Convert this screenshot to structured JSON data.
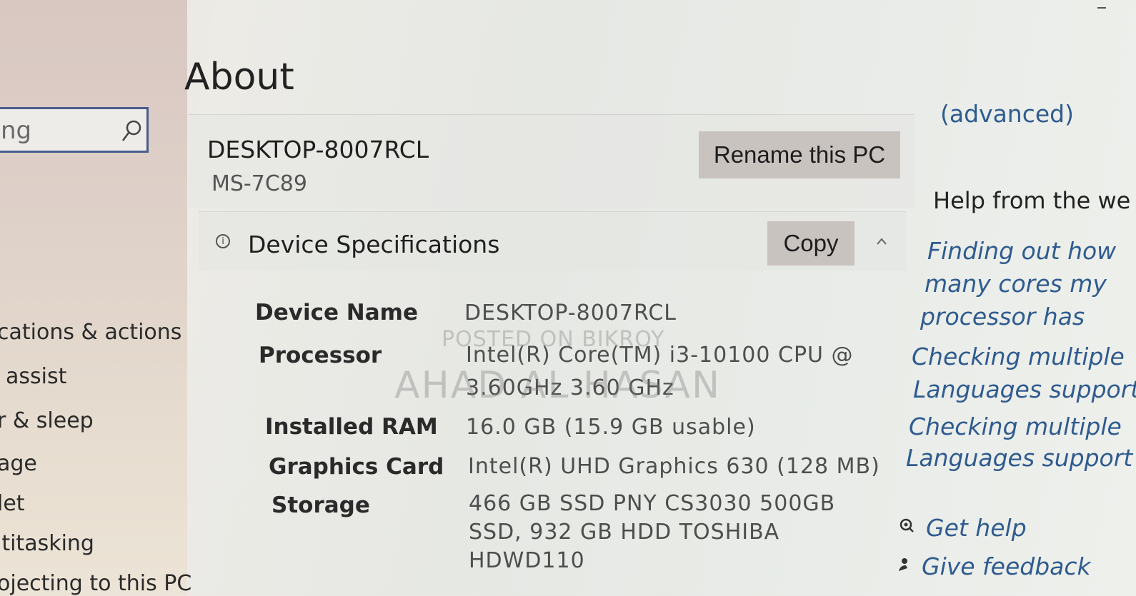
{
  "sidebar": {
    "search_value": "ng",
    "items": [
      "cations & actions",
      "assist",
      "r & sleep",
      "age",
      "let",
      "ltitasking",
      "ojecting to this PC"
    ]
  },
  "main": {
    "title": "About",
    "pc_name": "DESKTOP-8007RCL",
    "pc_model": "MS-7C89",
    "rename_button": "Rename this PC",
    "spec_section": {
      "title": "Device Specifications",
      "copy_button": "Copy",
      "rows": [
        {
          "label": "Device Name",
          "value": [
            "DESKTOP-8007RCL"
          ]
        },
        {
          "label": "Processor",
          "value": [
            "Intel(R)  Core(TM)  i3-10100  CPU  @",
            "3.60GHz   3.60 GHz"
          ]
        },
        {
          "label": "Installed RAM",
          "value": [
            "16.0 GB (15.9 GB usable)"
          ]
        },
        {
          "label": "Graphics Card",
          "value": [
            "Intel(R) UHD Graphics 630 (128 MB)"
          ]
        },
        {
          "label": "Storage",
          "value": [
            "466  GB  SSD  PNY  CS3030  500GB",
            "SSD,  932  GB  HDD  TOSHIBA",
            "HDWD110"
          ]
        }
      ]
    },
    "watermark": [
      "POSTED ON BIKROY",
      "AHAD AL HASAN"
    ]
  },
  "right_panel": {
    "advanced_fragment": "(advanced)",
    "help_heading": "Help from the we",
    "links": [
      [
        "Finding out how",
        "many cores my",
        "processor has"
      ],
      [
        "Checking multiple",
        "Languages support"
      ],
      [
        "Checking multiple",
        "Languages support"
      ]
    ],
    "get_help": "Get help",
    "give_feedback": "Give feedback"
  }
}
